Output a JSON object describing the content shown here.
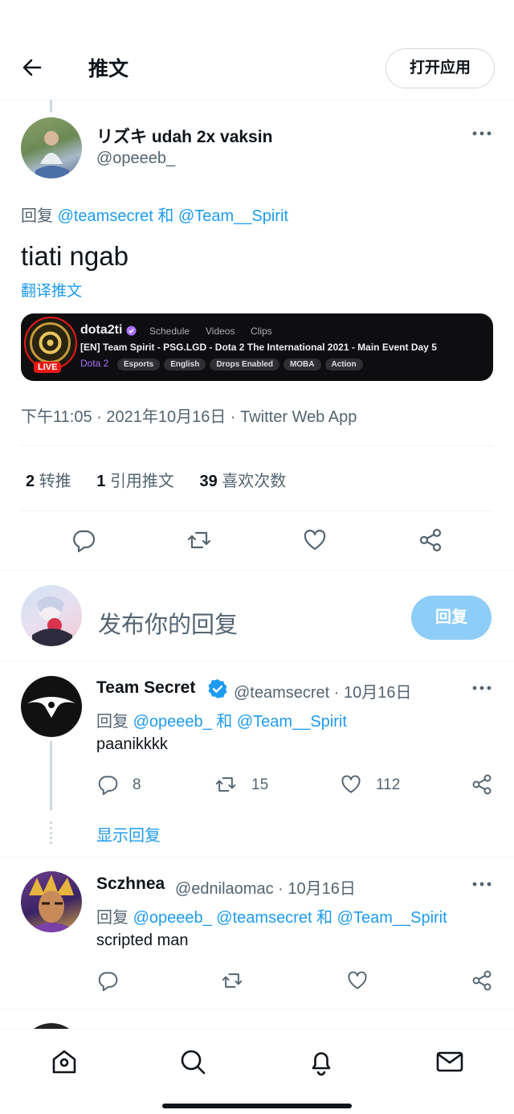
{
  "header": {
    "title": "推文",
    "open_app_label": "打开应用"
  },
  "tweet": {
    "display_name": "リズキ udah 2x vaksin",
    "handle": "@opeeeb_",
    "reply_prefix": "回复",
    "reply_to_1": "@teamsecret",
    "reply_and": "和",
    "reply_to_2": "@Team__Spirit",
    "text": "tiati ngab",
    "translate_label": "翻译推文",
    "timestamp": "下午11:05 · 2021年10月16日 · Twitter Web App",
    "retweets_count": "2",
    "retweets_label": "转推",
    "quotes_count": "1",
    "quotes_label": "引用推文",
    "likes_count": "39",
    "likes_label": "喜欢次数"
  },
  "embed": {
    "channel": "dota2ti",
    "nav_schedule": "Schedule",
    "nav_videos": "Videos",
    "nav_clips": "Clips",
    "stream_title": "[EN] Team Spirit - PSG.LGD - Dota 2 The International 2021 - Main Event Day 5",
    "game": "Dota 2",
    "tags": [
      "Esports",
      "English",
      "Drops Enabled",
      "MOBA",
      "Action"
    ],
    "live_label": "LIVE",
    "accent_color": "#a970ff"
  },
  "compose": {
    "placeholder": "发布你的回复",
    "reply_button": "回复"
  },
  "replies": [
    {
      "name": "Team Secret",
      "handle": "@teamsecret",
      "date": "· 10月16日",
      "reply_prefix": "回复",
      "mention_1": "@opeeeb_",
      "and_1": "和",
      "mention_2": "@Team__Spirit",
      "text": "paanikkkk",
      "replies_count": "8",
      "retweets_count": "15",
      "likes_count": "112",
      "show_replies": "显示回复"
    },
    {
      "name": "Sczhnea",
      "handle": "@ednilaomac",
      "date": "· 10月16日",
      "reply_prefix": "回复",
      "mention_1": "@opeeeb_",
      "mention_2": "@teamsecret",
      "and_1": "和",
      "mention_3": "@Team__Spirit",
      "text": "scripted man"
    }
  ],
  "nav": {
    "icons": [
      "home-icon",
      "search-icon",
      "bell-icon",
      "mail-icon"
    ]
  },
  "colors": {
    "brand_blue": "#1d9bf0",
    "verified_blue": "#1d9bf0",
    "reply_button_disabled": "#8ecdf7",
    "live_red": "#e91916"
  }
}
